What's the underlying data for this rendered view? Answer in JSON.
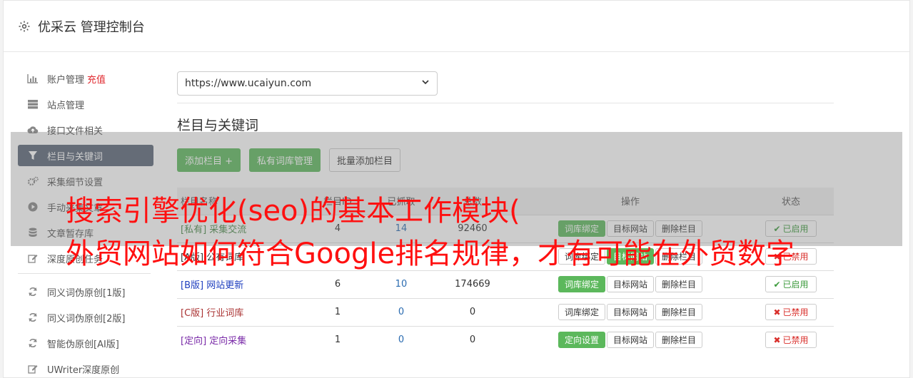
{
  "app": {
    "title": "优采云 管理控制台",
    "gear_icon": "gear-icon"
  },
  "sidebar": {
    "group1": [
      {
        "icon": "bar-chart-icon",
        "label": "账户管理",
        "accent": "充值"
      },
      {
        "icon": "server-icon",
        "label": "站点管理"
      },
      {
        "icon": "cloud-upload-icon",
        "label": "接口文件相关"
      },
      {
        "icon": "filter-icon",
        "label": "栏目与关键词",
        "active": true
      },
      {
        "icon": "gears-icon",
        "label": "采集细节设置"
      },
      {
        "icon": "play-circle-icon",
        "label": "手动采集文章"
      },
      {
        "icon": "database-icon",
        "label": "文章暂存库"
      },
      {
        "icon": "edit-icon",
        "label": "深度原创任务"
      }
    ],
    "group2": [
      {
        "icon": "refresh-icon",
        "label": "同义词伪原创[1版]"
      },
      {
        "icon": "refresh-icon",
        "label": "同义词伪原创[2版]"
      },
      {
        "icon": "refresh-icon",
        "label": "智能伪原创[AI版]"
      },
      {
        "icon": "edit-icon",
        "label": "UWriter深度原创"
      }
    ]
  },
  "main": {
    "site_select": "https://www.ucaiyun.com",
    "section_title": "栏目与关键词",
    "buttons": {
      "add_column": "添加栏目 +",
      "private_lib": "私有词库管理",
      "batch_add": "批量添加栏目"
    },
    "table": {
      "headers": {
        "name": "栏目名称",
        "id": "栏目ID",
        "fetched": "已抓取",
        "total": "总数",
        "ops": "操作",
        "state": "状态"
      },
      "rows": [
        {
          "tag": "[私有]",
          "name": "采集交流",
          "tag_class": "tag-private",
          "id": "4",
          "fetched": "14",
          "total": "92460",
          "op1": "词库绑定",
          "op1_green": true,
          "op2": "目标网站",
          "op3": "删除栏目",
          "state": "已启用",
          "on": true
        },
        {
          "tag": "[A版]",
          "name": "公有词库",
          "tag_class": "tag-a",
          "id": "1",
          "fetched": "",
          "total": "",
          "op1": "词库绑定",
          "op1_green": false,
          "op2": "目标网站",
          "op2_green": true,
          "op3": "删除栏目",
          "state": "已禁用",
          "on": false
        },
        {
          "tag": "[B版]",
          "name": "网站更新",
          "tag_class": "tag-b",
          "id": "6",
          "fetched": "10",
          "total": "174669",
          "op1": "词库绑定",
          "op1_green": true,
          "op2": "目标网站",
          "op3": "删除栏目",
          "state": "已启用",
          "on": true
        },
        {
          "tag": "[C版]",
          "name": "行业词库",
          "tag_class": "tag-c",
          "id": "1",
          "fetched": "0",
          "total": "0",
          "op1": "词库绑定",
          "op1_green": false,
          "op2": "目标网站",
          "op3": "删除栏目",
          "state": "已禁用",
          "on": false
        },
        {
          "tag": "[定向]",
          "name": "定向采集",
          "tag_class": "tag-d",
          "id": "1",
          "fetched": "0",
          "total": "0",
          "op1": "定向设置",
          "op1_green": true,
          "op2": "目标网站",
          "op3": "删除栏目",
          "state": "已禁用",
          "on": false
        }
      ]
    }
  },
  "overlay": {
    "line1": "搜索引擎优化(seo)的基本工作模块(",
    "line2": "外贸网站如何符合Google排名规律，才有可能在外贸数字"
  },
  "colors": {
    "active_nav": "#5a6577",
    "green": "#5cb85c",
    "red_text": "#ff1010"
  }
}
